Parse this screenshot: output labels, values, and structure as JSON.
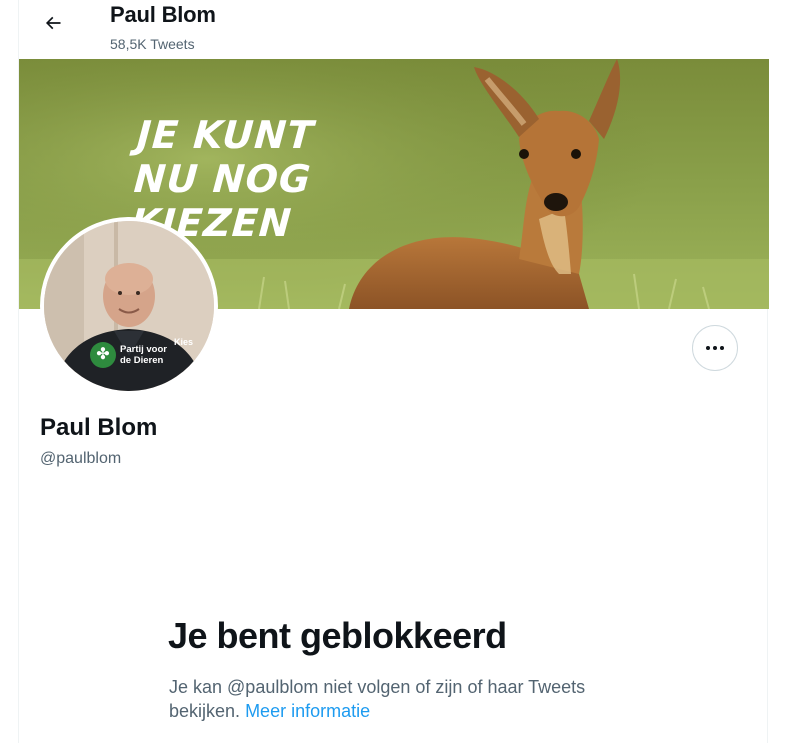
{
  "header": {
    "title": "Paul Blom",
    "tweet_count": "58,5K Tweets"
  },
  "banner": {
    "text_lines": [
      "JE KUNT",
      "NU NOG",
      "KIEZEN"
    ]
  },
  "avatar": {
    "logo_text_line1": "Partij voor",
    "logo_text_line2": "de Dieren",
    "kies_text": "Kies"
  },
  "profile": {
    "name": "Paul Blom",
    "handle": "@paulblom"
  },
  "blocked": {
    "title": "Je bent geblokkeerd",
    "message": "Je kan @paulblom niet volgen of zijn of haar Tweets bekijken.",
    "link": "Meer informatie"
  },
  "icons": {
    "back": "arrow-left-icon",
    "more": "more-dots-icon"
  },
  "colors": {
    "accent": "#1d9bf0",
    "secondary_text": "#536471",
    "border": "#cfd9de"
  }
}
